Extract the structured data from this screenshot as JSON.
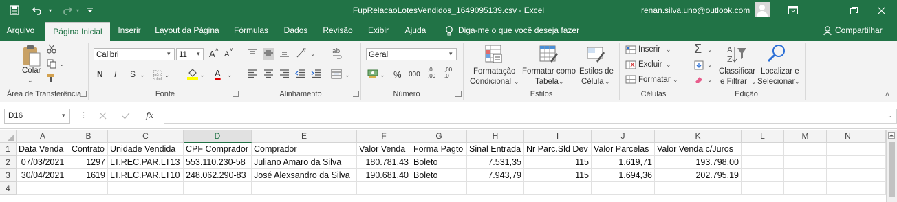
{
  "title_bar": {
    "file_title": "FupRelacaoLotesVendidos_1649095139.csv  -  Excel",
    "user_email": "renan.silva.uno@outlook.com"
  },
  "tabs": [
    "Arquivo",
    "Página Inicial",
    "Inserir",
    "Layout da Página",
    "Fórmulas",
    "Dados",
    "Revisão",
    "Exibir",
    "Ajuda"
  ],
  "tell_me": "Diga-me o que você deseja fazer",
  "share": "Compartilhar",
  "ribbon": {
    "clipboard": {
      "paste": "Colar",
      "group": "Área de Transferência"
    },
    "font": {
      "name": "Calibri",
      "size": "11",
      "bold": "N",
      "italic": "I",
      "underline": "S",
      "grow": "A",
      "shrink": "A",
      "color_letter": "A",
      "group": "Fonte"
    },
    "alignment": {
      "group": "Alinhamento"
    },
    "number": {
      "format": "Geral",
      "percent": "%",
      "thousands": "000",
      "inc_dec": ",0\n,00",
      "dec_dec": ",00\n,0",
      "group": "Número"
    },
    "styles": {
      "cond_line1": "Formatação",
      "cond_line2": "Condicional",
      "table_line1": "Formatar como",
      "table_line2": "Tabela",
      "cell_line1": "Estilos de",
      "cell_line2": "Célula",
      "group": "Estilos"
    },
    "cells": {
      "insert": "Inserir",
      "delete": "Excluir",
      "format": "Formatar",
      "group": "Células"
    },
    "editing": {
      "sort_line1": "Classificar",
      "sort_line2": "e Filtrar",
      "find_line1": "Localizar e",
      "find_line2": "Selecionar",
      "group": "Edição"
    }
  },
  "formula_bar": {
    "name_box": "D16",
    "fx": "fx",
    "content": ""
  },
  "sheet": {
    "columns": [
      "A",
      "B",
      "C",
      "D",
      "E",
      "F",
      "G",
      "H",
      "I",
      "J",
      "K",
      "L",
      "M",
      "N"
    ],
    "selected_column": "D",
    "row_numbers": [
      "1",
      "2",
      "3",
      "4"
    ],
    "rows": [
      [
        "Data Venda",
        "Contrato",
        "Unidade Vendida",
        "CPF Comprador",
        "Comprador",
        "Valor Venda",
        "Forma Pagto",
        "Sinal Entrada",
        "Nr Parc.Sld Dev",
        "Valor Parcelas",
        "Valor Venda c/Juros",
        "",
        "",
        ""
      ],
      [
        "07/03/2021",
        "1297",
        "LT.REC.PAR.LT13",
        "553.110.230-58",
        "Juliano Amaro da Silva",
        "180.781,43",
        "Boleto",
        "7.531,35",
        "115",
        "1.619,71",
        "193.798,00",
        "",
        "",
        ""
      ],
      [
        "30/04/2021",
        "1619",
        "LT.REC.PAR.LT10",
        "248.062.290-83",
        "José Alexsandro da Silva",
        "190.681,40",
        "Boleto",
        "7.943,79",
        "115",
        "1.694,36",
        "202.795,19",
        "",
        "",
        ""
      ],
      [
        "",
        "",
        "",
        "",
        "",
        "",
        "",
        "",
        "",
        "",
        "",
        "",
        "",
        ""
      ]
    ]
  },
  "colors": {
    "accent": "#217346",
    "ribbon_bg": "#f3f3f3",
    "header_bg": "#f3f3f3"
  }
}
